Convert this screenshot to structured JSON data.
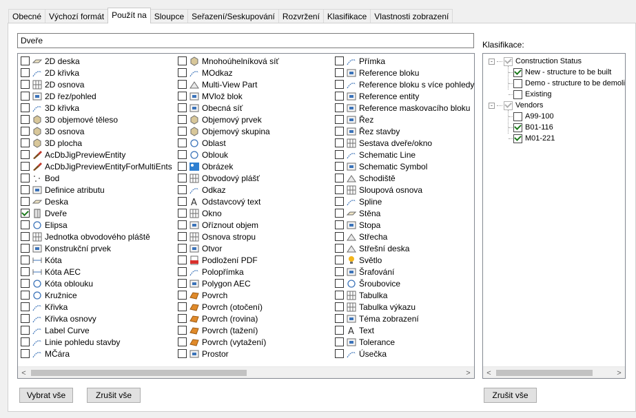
{
  "tabs": [
    {
      "label": "Obecné",
      "active": false
    },
    {
      "label": "Výchozí formát",
      "active": false
    },
    {
      "label": "Použít na",
      "active": true
    },
    {
      "label": "Sloupce",
      "active": false
    },
    {
      "label": "Seřazení/Seskupování",
      "active": false
    },
    {
      "label": "Rozvržení",
      "active": false
    },
    {
      "label": "Klasifikace",
      "active": false
    },
    {
      "label": "Vlastnosti zobrazení",
      "active": false
    }
  ],
  "filter": {
    "value": "Dveře"
  },
  "columns": [
    [
      {
        "label": "2D deska",
        "icon": "2d-slab-icon",
        "checked": false
      },
      {
        "label": "2D křivka",
        "icon": "2d-curve-icon",
        "checked": false
      },
      {
        "label": "2D osnova",
        "icon": "2d-grid-icon",
        "checked": false
      },
      {
        "label": "2D řez/pohled",
        "icon": "2d-section-icon",
        "checked": false
      },
      {
        "label": "3D křivka",
        "icon": "3d-curve-icon",
        "checked": false
      },
      {
        "label": "3D objemové těleso",
        "icon": "3d-solid-icon",
        "checked": false
      },
      {
        "label": "3D osnova",
        "icon": "3d-grid-icon",
        "checked": false
      },
      {
        "label": "3D plocha",
        "icon": "3d-face-icon",
        "checked": false
      },
      {
        "label": "AcDbJigPreviewEntity",
        "icon": "brush-icon",
        "checked": false
      },
      {
        "label": "AcDbJigPreviewEntityForMultiEnts",
        "icon": "brush-icon",
        "checked": false
      },
      {
        "label": "Bod",
        "icon": "point-icon",
        "checked": false
      },
      {
        "label": "Definice atributu",
        "icon": "tag-icon",
        "checked": false
      },
      {
        "label": "Deska",
        "icon": "slab-icon",
        "checked": false
      },
      {
        "label": "Dveře",
        "icon": "door-icon",
        "checked": true
      },
      {
        "label": "Elipsa",
        "icon": "ellipse-icon",
        "checked": false
      },
      {
        "label": "Jednotka obvodového pláště",
        "icon": "curtain-unit-icon",
        "checked": false
      },
      {
        "label": "Konstrukční prvek",
        "icon": "structural-member-icon",
        "checked": false
      },
      {
        "label": "Kóta",
        "icon": "dimension-icon",
        "checked": false
      },
      {
        "label": "Kóta AEC",
        "icon": "aec-dimension-icon",
        "checked": false
      },
      {
        "label": "Kóta oblouku",
        "icon": "arc-dimension-icon",
        "checked": false
      },
      {
        "label": "Kružnice",
        "icon": "circle-icon",
        "checked": false
      },
      {
        "label": "Křivka",
        "icon": "curve-icon",
        "checked": false
      },
      {
        "label": "Křivka osnovy",
        "icon": "layout-curve-icon",
        "checked": false
      },
      {
        "label": "Label Curve",
        "icon": "label-curve-icon",
        "checked": false
      },
      {
        "label": "Linie pohledu stavby",
        "icon": "view-line-icon",
        "checked": false
      },
      {
        "label": "MČára",
        "icon": "mline-icon",
        "checked": false
      }
    ],
    [
      {
        "label": "Mnohoúhelníková síť",
        "icon": "polyface-mesh-icon",
        "checked": false
      },
      {
        "label": "MOdkaz",
        "icon": "mleader-icon",
        "checked": false
      },
      {
        "label": "Multi-View Part",
        "icon": "mvpart-icon",
        "checked": false
      },
      {
        "label": "MVlož blok",
        "icon": "mvblock-icon",
        "checked": false
      },
      {
        "label": "Obecná síť",
        "icon": "mesh-icon",
        "checked": false
      },
      {
        "label": "Objemový prvek",
        "icon": "mass-element-icon",
        "checked": false
      },
      {
        "label": "Objemový skupina",
        "icon": "mass-group-icon",
        "checked": false
      },
      {
        "label": "Oblast",
        "icon": "region-icon",
        "checked": false
      },
      {
        "label": "Oblouk",
        "icon": "arc-icon",
        "checked": false
      },
      {
        "label": "Obrázek",
        "icon": "image-icon",
        "checked": false
      },
      {
        "label": "Obvodový plášť",
        "icon": "curtain-wall-icon",
        "checked": false
      },
      {
        "label": "Odkaz",
        "icon": "leader-icon",
        "checked": false
      },
      {
        "label": "Odstavcový text",
        "icon": "mtext-icon",
        "checked": false
      },
      {
        "label": "Okno",
        "icon": "window-icon",
        "checked": false
      },
      {
        "label": "Oříznout objem",
        "icon": "clip-volume-icon",
        "checked": false
      },
      {
        "label": "Osnova stropu",
        "icon": "ceiling-grid-icon",
        "checked": false
      },
      {
        "label": "Otvor",
        "icon": "opening-icon",
        "checked": false
      },
      {
        "label": "Podložení PDF",
        "icon": "pdf-icon",
        "checked": false
      },
      {
        "label": "Polopřímka",
        "icon": "ray-icon",
        "checked": false
      },
      {
        "label": "Polygon AEC",
        "icon": "aec-polygon-icon",
        "checked": false
      },
      {
        "label": "Povrch",
        "icon": "surface-icon",
        "checked": false
      },
      {
        "label": "Povrch (otočení)",
        "icon": "surface-revolve-icon",
        "checked": false
      },
      {
        "label": "Povrch (rovina)",
        "icon": "surface-plane-icon",
        "checked": false
      },
      {
        "label": "Povrch (tažení)",
        "icon": "surface-sweep-icon",
        "checked": false
      },
      {
        "label": "Povrch (vytažení)",
        "icon": "surface-extrude-icon",
        "checked": false
      },
      {
        "label": "Prostor",
        "icon": "space-icon",
        "checked": false
      }
    ],
    [
      {
        "label": "Přímka",
        "icon": "xline-icon",
        "checked": false
      },
      {
        "label": "Reference bloku",
        "icon": "block-ref-icon",
        "checked": false
      },
      {
        "label": "Reference bloku s více pohledy",
        "icon": "multiview-block-icon",
        "checked": false
      },
      {
        "label": "Reference entity",
        "icon": "entity-ref-icon",
        "checked": false
      },
      {
        "label": "Reference maskovacího bloku",
        "icon": "mask-block-icon",
        "checked": false
      },
      {
        "label": "Řez",
        "icon": "section-icon",
        "checked": false
      },
      {
        "label": "Řez stavby",
        "icon": "building-section-icon",
        "checked": false
      },
      {
        "label": "Sestava dveře/okno",
        "icon": "door-window-assembly-icon",
        "checked": false
      },
      {
        "label": "Schematic Line",
        "icon": "schematic-line-icon",
        "checked": false
      },
      {
        "label": "Schematic Symbol",
        "icon": "schematic-symbol-icon",
        "checked": false
      },
      {
        "label": "Schodiště",
        "icon": "stair-icon",
        "checked": false
      },
      {
        "label": "Sloupová osnova",
        "icon": "column-grid-icon",
        "checked": false
      },
      {
        "label": "Spline",
        "icon": "spline-icon",
        "checked": false
      },
      {
        "label": "Stěna",
        "icon": "wall-icon",
        "checked": false
      },
      {
        "label": "Stopa",
        "icon": "trace-icon",
        "checked": false
      },
      {
        "label": "Střecha",
        "icon": "roof-icon",
        "checked": false
      },
      {
        "label": "Střešní deska",
        "icon": "roof-slab-icon",
        "checked": false
      },
      {
        "label": "Světlo",
        "icon": "light-icon",
        "checked": false
      },
      {
        "label": "Šrafování",
        "icon": "hatch-icon",
        "checked": false
      },
      {
        "label": "Šroubovice",
        "icon": "helix-icon",
        "checked": false
      },
      {
        "label": "Tabulka",
        "icon": "table-icon",
        "checked": false
      },
      {
        "label": "Tabulka výkazu",
        "icon": "schedule-table-icon",
        "checked": false
      },
      {
        "label": "Téma zobrazení",
        "icon": "display-theme-icon",
        "checked": false
      },
      {
        "label": "Text",
        "icon": "text-icon",
        "checked": false
      },
      {
        "label": "Tolerance",
        "icon": "tolerance-icon",
        "checked": false
      },
      {
        "label": "Úsečka",
        "icon": "line-icon",
        "checked": false
      }
    ]
  ],
  "klasifikace": {
    "label": "Klasifikace:",
    "tree": [
      {
        "label": "Construction Status",
        "level": 0,
        "checked": true,
        "gray": true,
        "expand": "-"
      },
      {
        "label": "New - structure to be built",
        "level": 1,
        "checked": true,
        "gray": false
      },
      {
        "label": "Demo - structure to be demolis",
        "level": 1,
        "checked": false,
        "gray": false
      },
      {
        "label": "Existing",
        "level": 1,
        "checked": false,
        "gray": false
      },
      {
        "label": "Vendors",
        "level": 0,
        "checked": true,
        "gray": true,
        "expand": "-"
      },
      {
        "label": "A99-100",
        "level": 1,
        "checked": false,
        "gray": false
      },
      {
        "label": "B01-116",
        "level": 1,
        "checked": true,
        "gray": false
      },
      {
        "label": "M01-221",
        "level": 1,
        "checked": true,
        "gray": false
      }
    ]
  },
  "buttons": {
    "select_all": "Vybrat vše",
    "clear_all": "Zrušit vše",
    "clear_all_klas": "Zrušit vše"
  },
  "scroll": {
    "arrow_left": "<",
    "arrow_right": ">"
  },
  "colors": {
    "check": "#1a7a1a",
    "icon_blue": "#3b73b9",
    "icon_gray": "#6b6b6b"
  }
}
